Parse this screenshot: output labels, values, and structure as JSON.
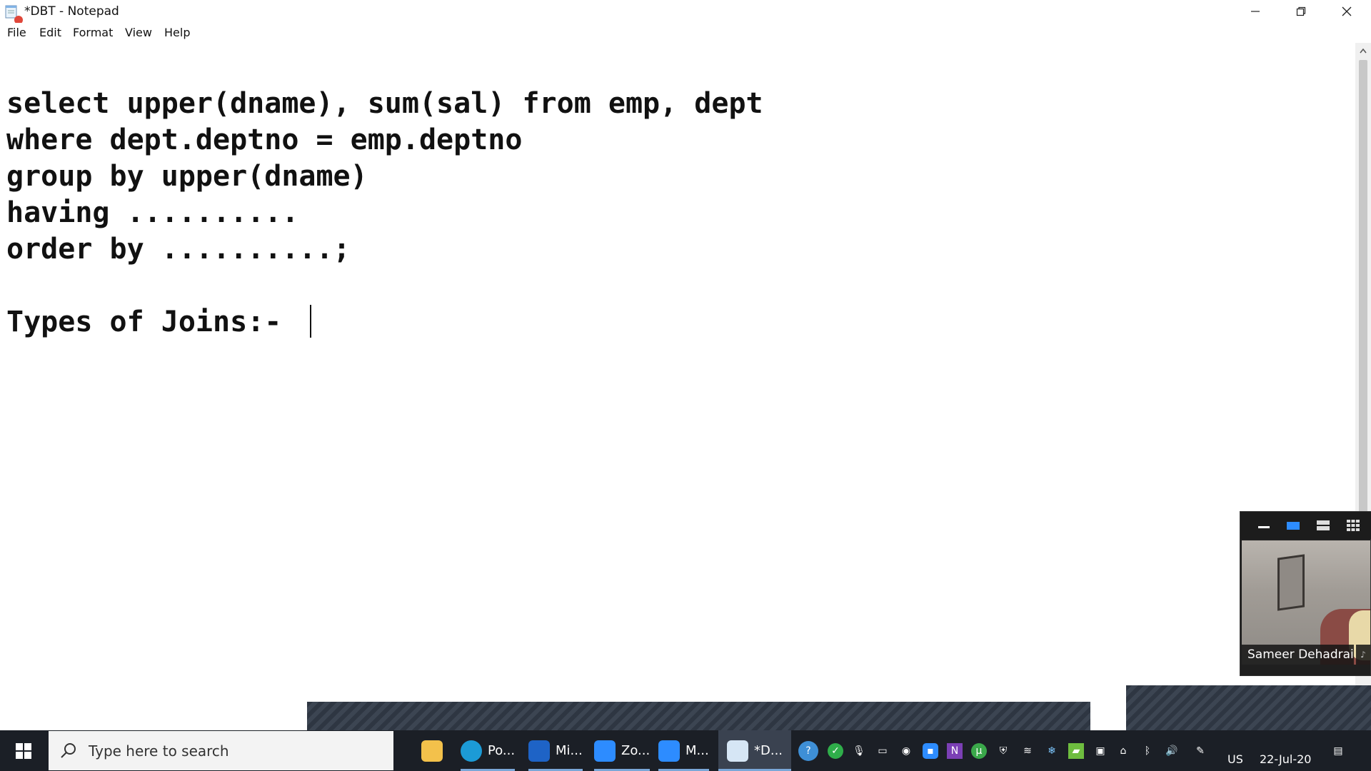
{
  "window": {
    "title": "*DBT - Notepad",
    "menu": [
      "File",
      "Edit",
      "Format",
      "View",
      "Help"
    ]
  },
  "editor": {
    "lines": [
      "select upper(dname), sum(sal) from emp, dept",
      "where dept.deptno = emp.deptno",
      "group by upper(dname)",
      "having ..........",
      "order by ..........;",
      "",
      "Types of Joins:-"
    ]
  },
  "zoom_panel": {
    "participant_name": "Sameer Dehadrai"
  },
  "taskbar": {
    "search_placeholder": "Type here to search",
    "apps": [
      {
        "icon": "file-explorer-icon",
        "label": ""
      },
      {
        "icon": "edge-icon",
        "label": "Po..."
      },
      {
        "icon": "whiteboard-icon",
        "label": "Mi..."
      },
      {
        "icon": "zoom-icon",
        "label": "Zo..."
      },
      {
        "icon": "zoom-meeting-icon",
        "label": "M..."
      },
      {
        "icon": "notepad-icon",
        "label": "*D..."
      }
    ],
    "language": "US",
    "date": "22-Jul-20"
  },
  "colors": {
    "taskbar": "#1b1f26",
    "zoom_active_view": "#2d8cff",
    "window_bg": "#ffffff"
  }
}
